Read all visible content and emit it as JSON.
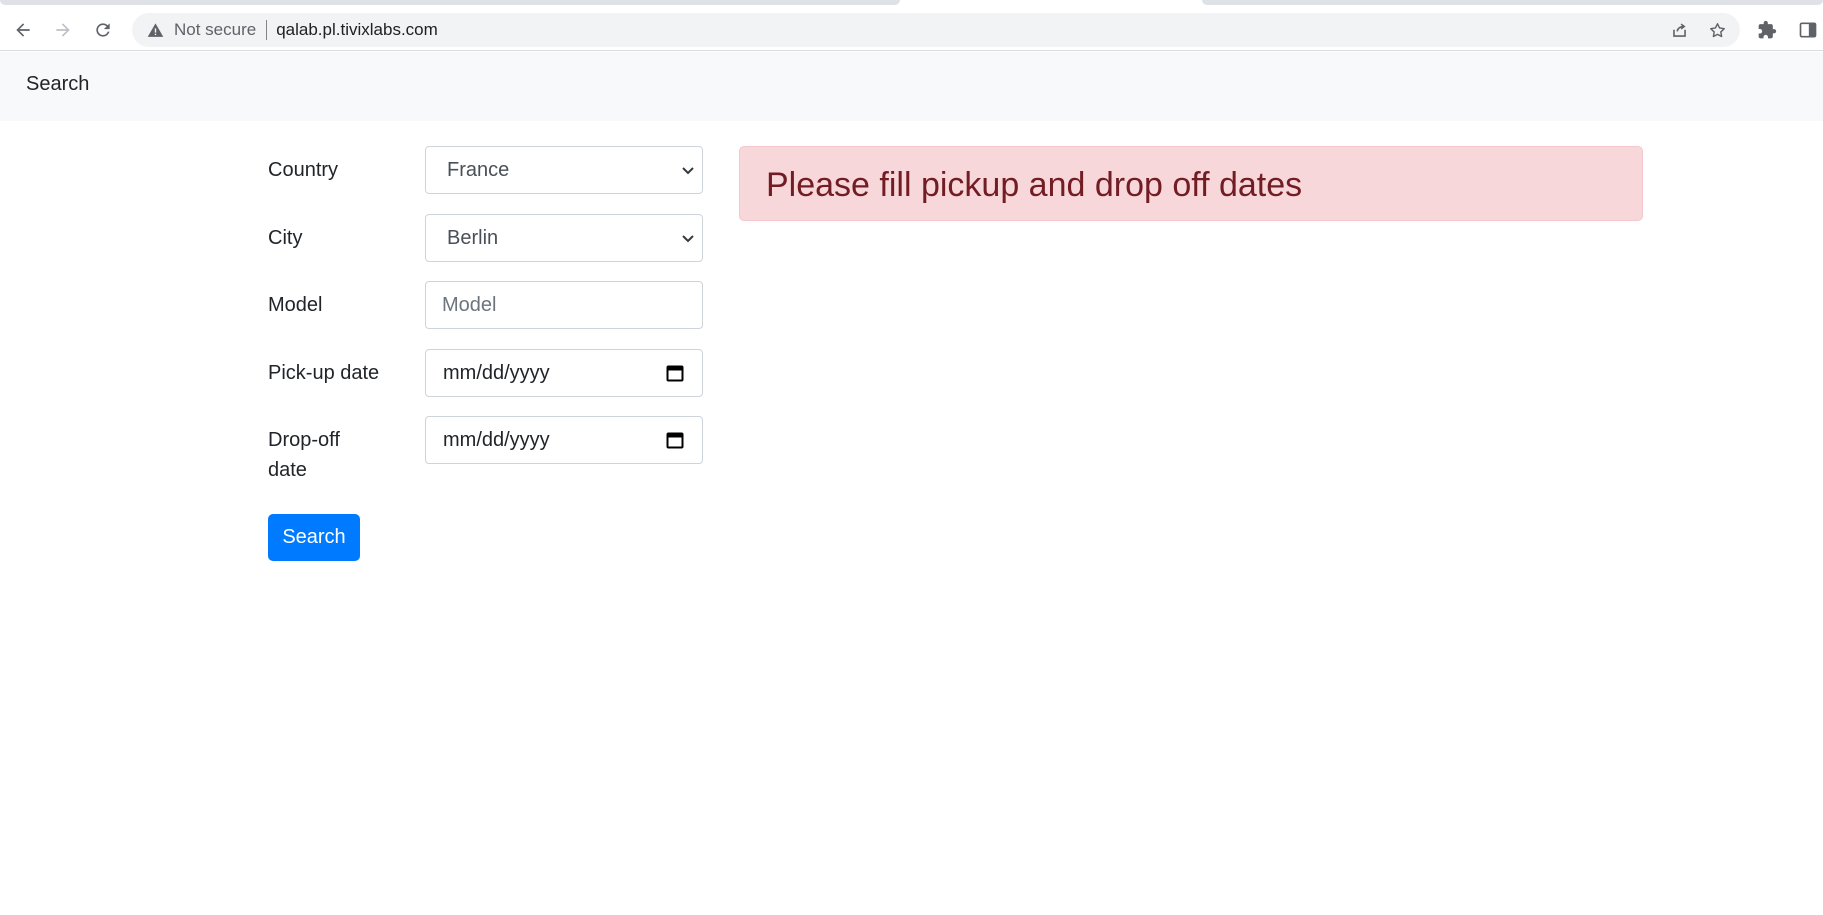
{
  "browser": {
    "security_status": "Not secure",
    "url": "qalab.pl.tivixlabs.com"
  },
  "navbar": {
    "brand": "Search"
  },
  "form": {
    "country": {
      "label": "Country",
      "value": "France"
    },
    "city": {
      "label": "City",
      "value": "Berlin"
    },
    "model": {
      "label": "Model",
      "placeholder": "Model"
    },
    "pickup": {
      "label": "Pick-up date",
      "value": "mm/dd/yyyy"
    },
    "dropoff": {
      "label_line1": "Drop-off",
      "label_line2": "date",
      "value": "mm/dd/yyyy"
    },
    "submit_label": "Search"
  },
  "alert": {
    "message": "Please fill pickup and drop off dates",
    "colors": {
      "background": "#f8d7da",
      "border": "#f5c6cb",
      "text": "#721c24"
    }
  },
  "colors": {
    "primary": "#007bff",
    "navbar_bg": "#f8f9fa"
  }
}
